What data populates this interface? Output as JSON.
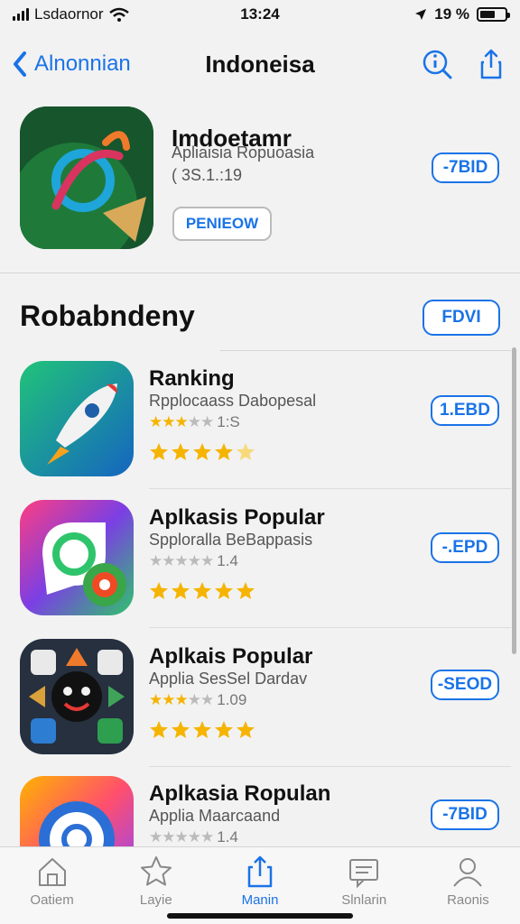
{
  "status": {
    "carrier": "Lsdaornor",
    "time": "13:24",
    "battery_pct": "19 %",
    "battery_level": 0.6
  },
  "nav": {
    "back_label": "Alnonnian",
    "title": "Indoneisa",
    "info_icon": "info-search-icon",
    "share_icon": "share-icon"
  },
  "featured": {
    "name": "Imdoetamr",
    "subtitle": "Apliaisia Ropuoasia",
    "version": "( 3S.1.:19",
    "review_label": "PENIEOW",
    "action_label": "-7BID"
  },
  "section": {
    "title": "Robabndeny",
    "action_label": "FDVI"
  },
  "apps": [
    {
      "name": "Ranking",
      "subtitle": "Rpplocaass Dabopesal",
      "rating_text": "1:S",
      "rating_value": 3,
      "action_label": "1.EBD",
      "stars_full": 4,
      "stars_half": 1,
      "icon": "rocket-icon"
    },
    {
      "name": "Aplkasis Popular",
      "subtitle": "Spploralla BeBappasis",
      "rating_text": "1.4",
      "rating_value": 0,
      "action_label": "-.EPD",
      "stars_full": 5,
      "stars_half": 0,
      "icon": "camera-icon"
    },
    {
      "name": "Aplkais Popular",
      "subtitle": "Applia SesSel Dardav",
      "rating_text": "1.09",
      "rating_value": 3,
      "action_label": "-SEOD",
      "stars_full": 5,
      "stars_half": 0,
      "icon": "game-icon"
    },
    {
      "name": "Aplkasia Ropulan",
      "subtitle": "Applia Maarcaand",
      "rating_text": "1.4",
      "rating_value": 0,
      "action_label": "-7BID",
      "stars_full": 0,
      "stars_half": 0,
      "icon": "music-icon"
    }
  ],
  "tabs": [
    {
      "label": "Oatiem",
      "icon": "home-icon",
      "active": false
    },
    {
      "label": "Layie",
      "icon": "star-icon",
      "active": false
    },
    {
      "label": "Manin",
      "icon": "upload-icon",
      "active": true
    },
    {
      "label": "Slnlarin",
      "icon": "message-icon",
      "active": false
    },
    {
      "label": "Raonis",
      "icon": "person-icon",
      "active": false
    }
  ],
  "colors": {
    "accent": "#1a73e8",
    "star": "#f5b400",
    "background": "#f2f2f2"
  }
}
